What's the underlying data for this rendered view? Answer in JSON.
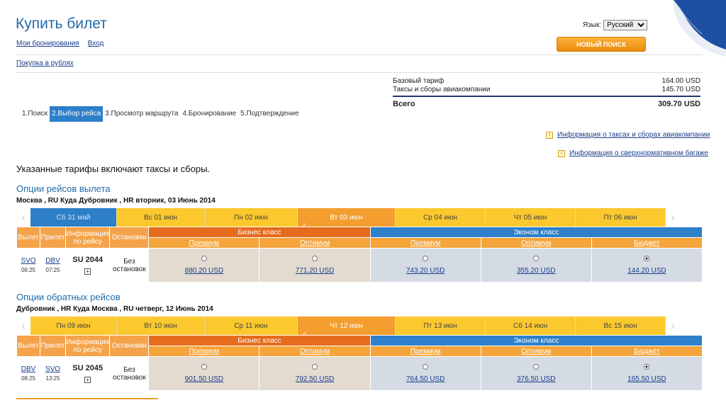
{
  "header": {
    "title": "Купить билет",
    "my_bookings": "Мои бронирования",
    "login": "Вход",
    "rub_purchase": "Покупка в рублях",
    "lang_label": "Язык:",
    "lang_value": "Русский",
    "new_search": "НОВЫЙ ПОИСК"
  },
  "summary": {
    "base_label": "Базовый тариф",
    "base_value": "164.00 USD",
    "tax_label": "Таксы и сборы авиакомпании",
    "tax_value": "145.70 USD",
    "total_label": "Всего",
    "total_value": "309.70 USD"
  },
  "steps": [
    "1.Поиск",
    "2.Выбор рейса",
    "3.Просмотр маршрута",
    "4.Бронирование",
    "5.Подтверждение"
  ],
  "info_links": {
    "taxes": "Информация о таксах и сборах авиакомпании",
    "baggage": "Информация о сверхнормативном багаже"
  },
  "note": "Указанные тарифы включают таксы и сборы.",
  "headers": {
    "dep": "Вылет",
    "arr": "Прилет",
    "info": "Информация по рейсу",
    "stops": "Остановки",
    "business": "Бизнес класс",
    "economy": "Эконом класс",
    "premium": "Премиум",
    "optimum": "Оптимум",
    "budget": "Бюджет"
  },
  "outbound": {
    "title": "Опции рейсов вылета",
    "route": "Москва , RU Куда Дубровник , HR вторник, 03 Июнь 2014",
    "days": [
      "Сб 31 май",
      "Вс 01 июн",
      "Пн 02 июн",
      "Вт 03 июн",
      "Ср 04 июн",
      "Чт 05 июн",
      "Пт 06 июн"
    ],
    "from": "SVO",
    "from_time": "06:25",
    "to": "DBV",
    "to_time": "07:25",
    "flight": "SU 2044",
    "stops": "Без остановок",
    "prices": [
      "880.20 USD",
      "771.20 USD",
      "743.20 USD",
      "355.20 USD",
      "144.20 USD"
    ]
  },
  "inbound": {
    "title": "Опции обратных рейсов",
    "route": "Дубровник , HR Куда Москва , RU четверг, 12 Июнь 2014",
    "days": [
      "Пн 09 июн",
      "Вт 10 июн",
      "Ср 11 июн",
      "Чт 12 июн",
      "Пт 13 июн",
      "Сб 14 июн",
      "Вс 15 июн"
    ],
    "from": "DBV",
    "from_time": "08:25",
    "to": "SVO",
    "to_time": "13:25",
    "flight": "SU 2045",
    "stops": "Без остановок",
    "prices": [
      "901.50 USD",
      "792.50 USD",
      "764.50 USD",
      "376.50 USD",
      "165.50 USD"
    ]
  },
  "colors": {
    "accent": "#1f6aa8",
    "orange": "#f39e2e",
    "yellow": "#fbc82d",
    "blue": "#2d7fc8"
  }
}
